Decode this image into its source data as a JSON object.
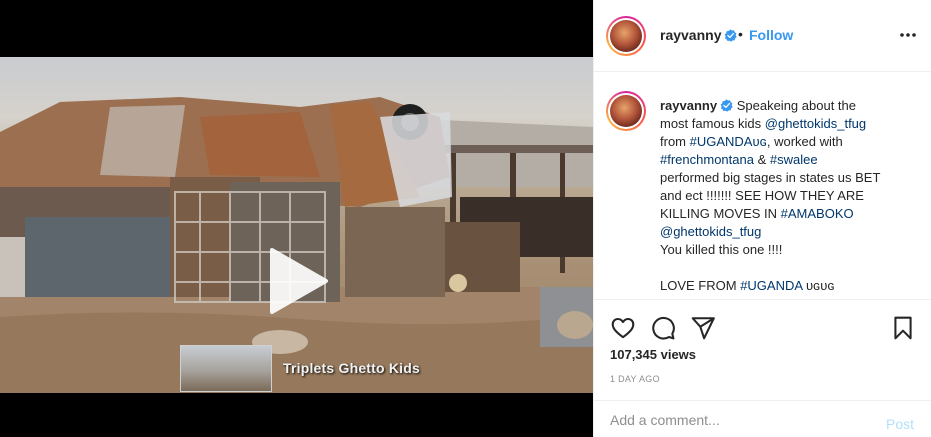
{
  "video": {
    "overlay_caption": "Triplets Ghetto Kids"
  },
  "header": {
    "username": "rayvanny",
    "separator": "•",
    "follow_label": "Follow"
  },
  "caption": {
    "username": "rayvanny",
    "lines": [
      {
        "segments": [
          {
            "text": "Speakeing about the"
          }
        ]
      },
      {
        "segments": [
          {
            "text": "most famous kids "
          },
          {
            "text": "@ghettokids_tfug",
            "link": true
          }
        ]
      },
      {
        "segments": [
          {
            "text": "from "
          },
          {
            "text": "#UGANDA",
            "link": true
          },
          {
            "text": "ᴜɢ",
            "link": true
          },
          {
            "text": ", worked with"
          }
        ]
      },
      {
        "segments": [
          {
            "text": "#frenchmontana",
            "link": true
          },
          {
            "text": " & "
          },
          {
            "text": "#swalee",
            "link": true
          }
        ]
      },
      {
        "segments": [
          {
            "text": "performed big stages in states us BET"
          }
        ]
      },
      {
        "segments": [
          {
            "text": "and ect !!!!!!! SEE HOW THEY ARE"
          }
        ]
      },
      {
        "segments": [
          {
            "text": "KILLING MOVES IN "
          },
          {
            "text": "#AMABOKO",
            "link": true
          }
        ]
      },
      {
        "segments": [
          {
            "text": "@ghettokids_tfug",
            "link": true
          }
        ]
      },
      {
        "segments": [
          {
            "text": "You killed this one !!!!"
          }
        ]
      },
      {
        "segments": []
      },
      {
        "segments": [
          {
            "text": "LOVE FROM "
          },
          {
            "text": "#UGANDA",
            "link": true
          },
          {
            "text": " ᴜɢᴜɢ"
          }
        ]
      }
    ]
  },
  "stats": {
    "views": "107,345 views",
    "timestamp": "1 DAY AGO"
  },
  "comment": {
    "placeholder": "Add a comment...",
    "post_label": "Post"
  },
  "colors": {
    "link": "#00376b",
    "follow": "#3897f0",
    "post_disabled": "#b2dffc",
    "muted": "#8e8e8e"
  }
}
